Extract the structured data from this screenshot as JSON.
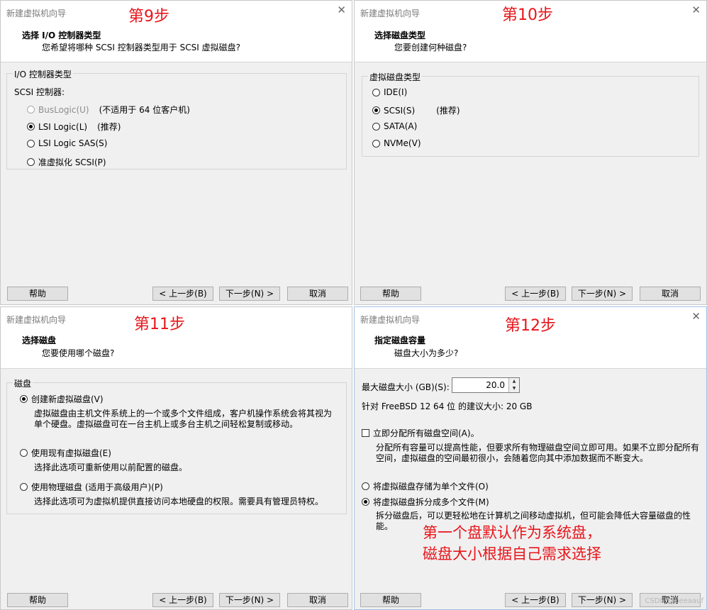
{
  "steps": [
    "第9步",
    "第10步",
    "第11步",
    "第12步"
  ],
  "window_title": "新建虚拟机向导",
  "close": "✕",
  "buttons": {
    "help": "帮助",
    "back": "< 上一步(B)",
    "next": "下一步(N) >",
    "cancel": "取消"
  },
  "p1": {
    "title": "选择 I/O 控制器类型",
    "subtitle": "您希望将哪种 SCSI 控制器类型用于 SCSI 虚拟磁盘?",
    "group": "I/O 控制器类型",
    "scsi_label": "SCSI 控制器:",
    "options": [
      {
        "label": "BusLogic(U)",
        "note": "(不适用于 64 位客户机)"
      },
      {
        "label": "LSI Logic(L)",
        "note": "(推荐)"
      },
      {
        "label": "LSI Logic SAS(S)",
        "note": ""
      },
      {
        "label": "准虚拟化 SCSI(P)",
        "note": ""
      }
    ]
  },
  "p2": {
    "title": "选择磁盘类型",
    "subtitle": "您要创建何种磁盘?",
    "group": "虚拟磁盘类型",
    "options": [
      {
        "label": "IDE(I)",
        "note": ""
      },
      {
        "label": "SCSI(S)",
        "note": "(推荐)"
      },
      {
        "label": "SATA(A)",
        "note": ""
      },
      {
        "label": "NVMe(V)",
        "note": ""
      }
    ]
  },
  "p3": {
    "title": "选择磁盘",
    "subtitle": "您要使用哪个磁盘?",
    "group": "磁盘",
    "options": [
      {
        "label": "创建新虚拟磁盘(V)",
        "desc1": "虚拟磁盘由主机文件系统上的一个或多个文件组成，客户机操作系统会将其视为",
        "desc2": "单个硬盘。虚拟磁盘可在一台主机上或多台主机之间轻松复制或移动。"
      },
      {
        "label": "使用现有虚拟磁盘(E)",
        "desc1": "选择此选项可重新使用以前配置的磁盘。"
      },
      {
        "label": "使用物理磁盘 (适用于高级用户)(P)",
        "desc1": "选择此选项可为虚拟机提供直接访问本地硬盘的权限。需要具有管理员特权。"
      }
    ]
  },
  "p4": {
    "title": "指定磁盘容量",
    "subtitle": "磁盘大小为多少?",
    "max_size_label": "最大磁盘大小 (GB)(S):",
    "max_size_value": "20.0",
    "recommend": "针对 FreeBSD 12 64 位 的建议大小: 20 GB",
    "allocate_label": "立即分配所有磁盘空间(A)。",
    "allocate_desc1": "分配所有容量可以提高性能，但要求所有物理磁盘空间立即可用。如果不立即分配所有",
    "allocate_desc2": "空间，虚拟磁盘的空间最初很小，会随着您向其中添加数据而不断变大。",
    "single_label": "将虚拟磁盘存储为单个文件(O)",
    "multi_label": "将虚拟磁盘拆分成多个文件(M)",
    "multi_desc1": "拆分磁盘后，可以更轻松地在计算机之间移动虚拟机，但可能会降低大容量磁盘的性",
    "multi_desc2": "能。",
    "annotation1": "第一个盘默认作为系统盘，",
    "annotation2": "磁盘大小根据自己需求选择",
    "watermark": "CSDN @beeaauf"
  }
}
